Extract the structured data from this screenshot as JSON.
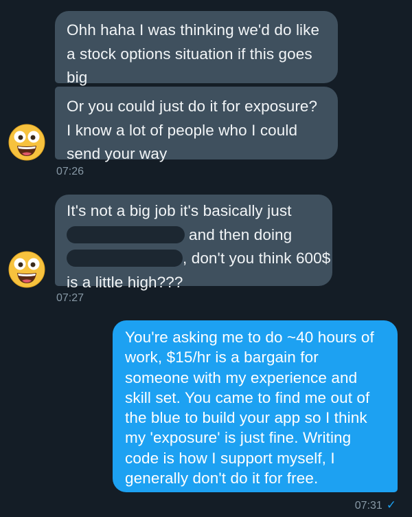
{
  "messages": {
    "group1": {
      "bubble1": {
        "lines": [
          "Ohh haha I was thinking we'd do like",
          "a stock options situation if this goes",
          "big"
        ]
      },
      "bubble2": {
        "lines": [
          "Or you could just do it for exposure?",
          "I know a lot of people who I could",
          "send your way"
        ]
      },
      "time": "07:26"
    },
    "group2": {
      "bubble1": {
        "line1": "It's not a big job it's basically just",
        "line2_after": "and then doing",
        "line3_after": ", don't you think 600$",
        "line4": "is a little high???"
      },
      "time": "07:27"
    },
    "group3": {
      "bubble1": {
        "lines": [
          "You're asking me to do ~40 hours of",
          "work, $15/hr is a bargain for",
          "someone with my experience and",
          "skill set. You came to find me out of",
          "the blue to build your app so I think",
          "my 'exposure' is just fine. Writing",
          "code is how I support myself, I",
          "generally don't do it for free."
        ]
      },
      "time": "07:31",
      "read_icon": "checkmark-icon"
    }
  },
  "avatar_icon": "grinning-face-emoji-icon",
  "colors": {
    "background": "#141d26",
    "incoming_bubble": "#3f505e",
    "outgoing_bubble": "#1da1f2",
    "timestamp": "#8899a6",
    "redaction": "#1c2731"
  }
}
